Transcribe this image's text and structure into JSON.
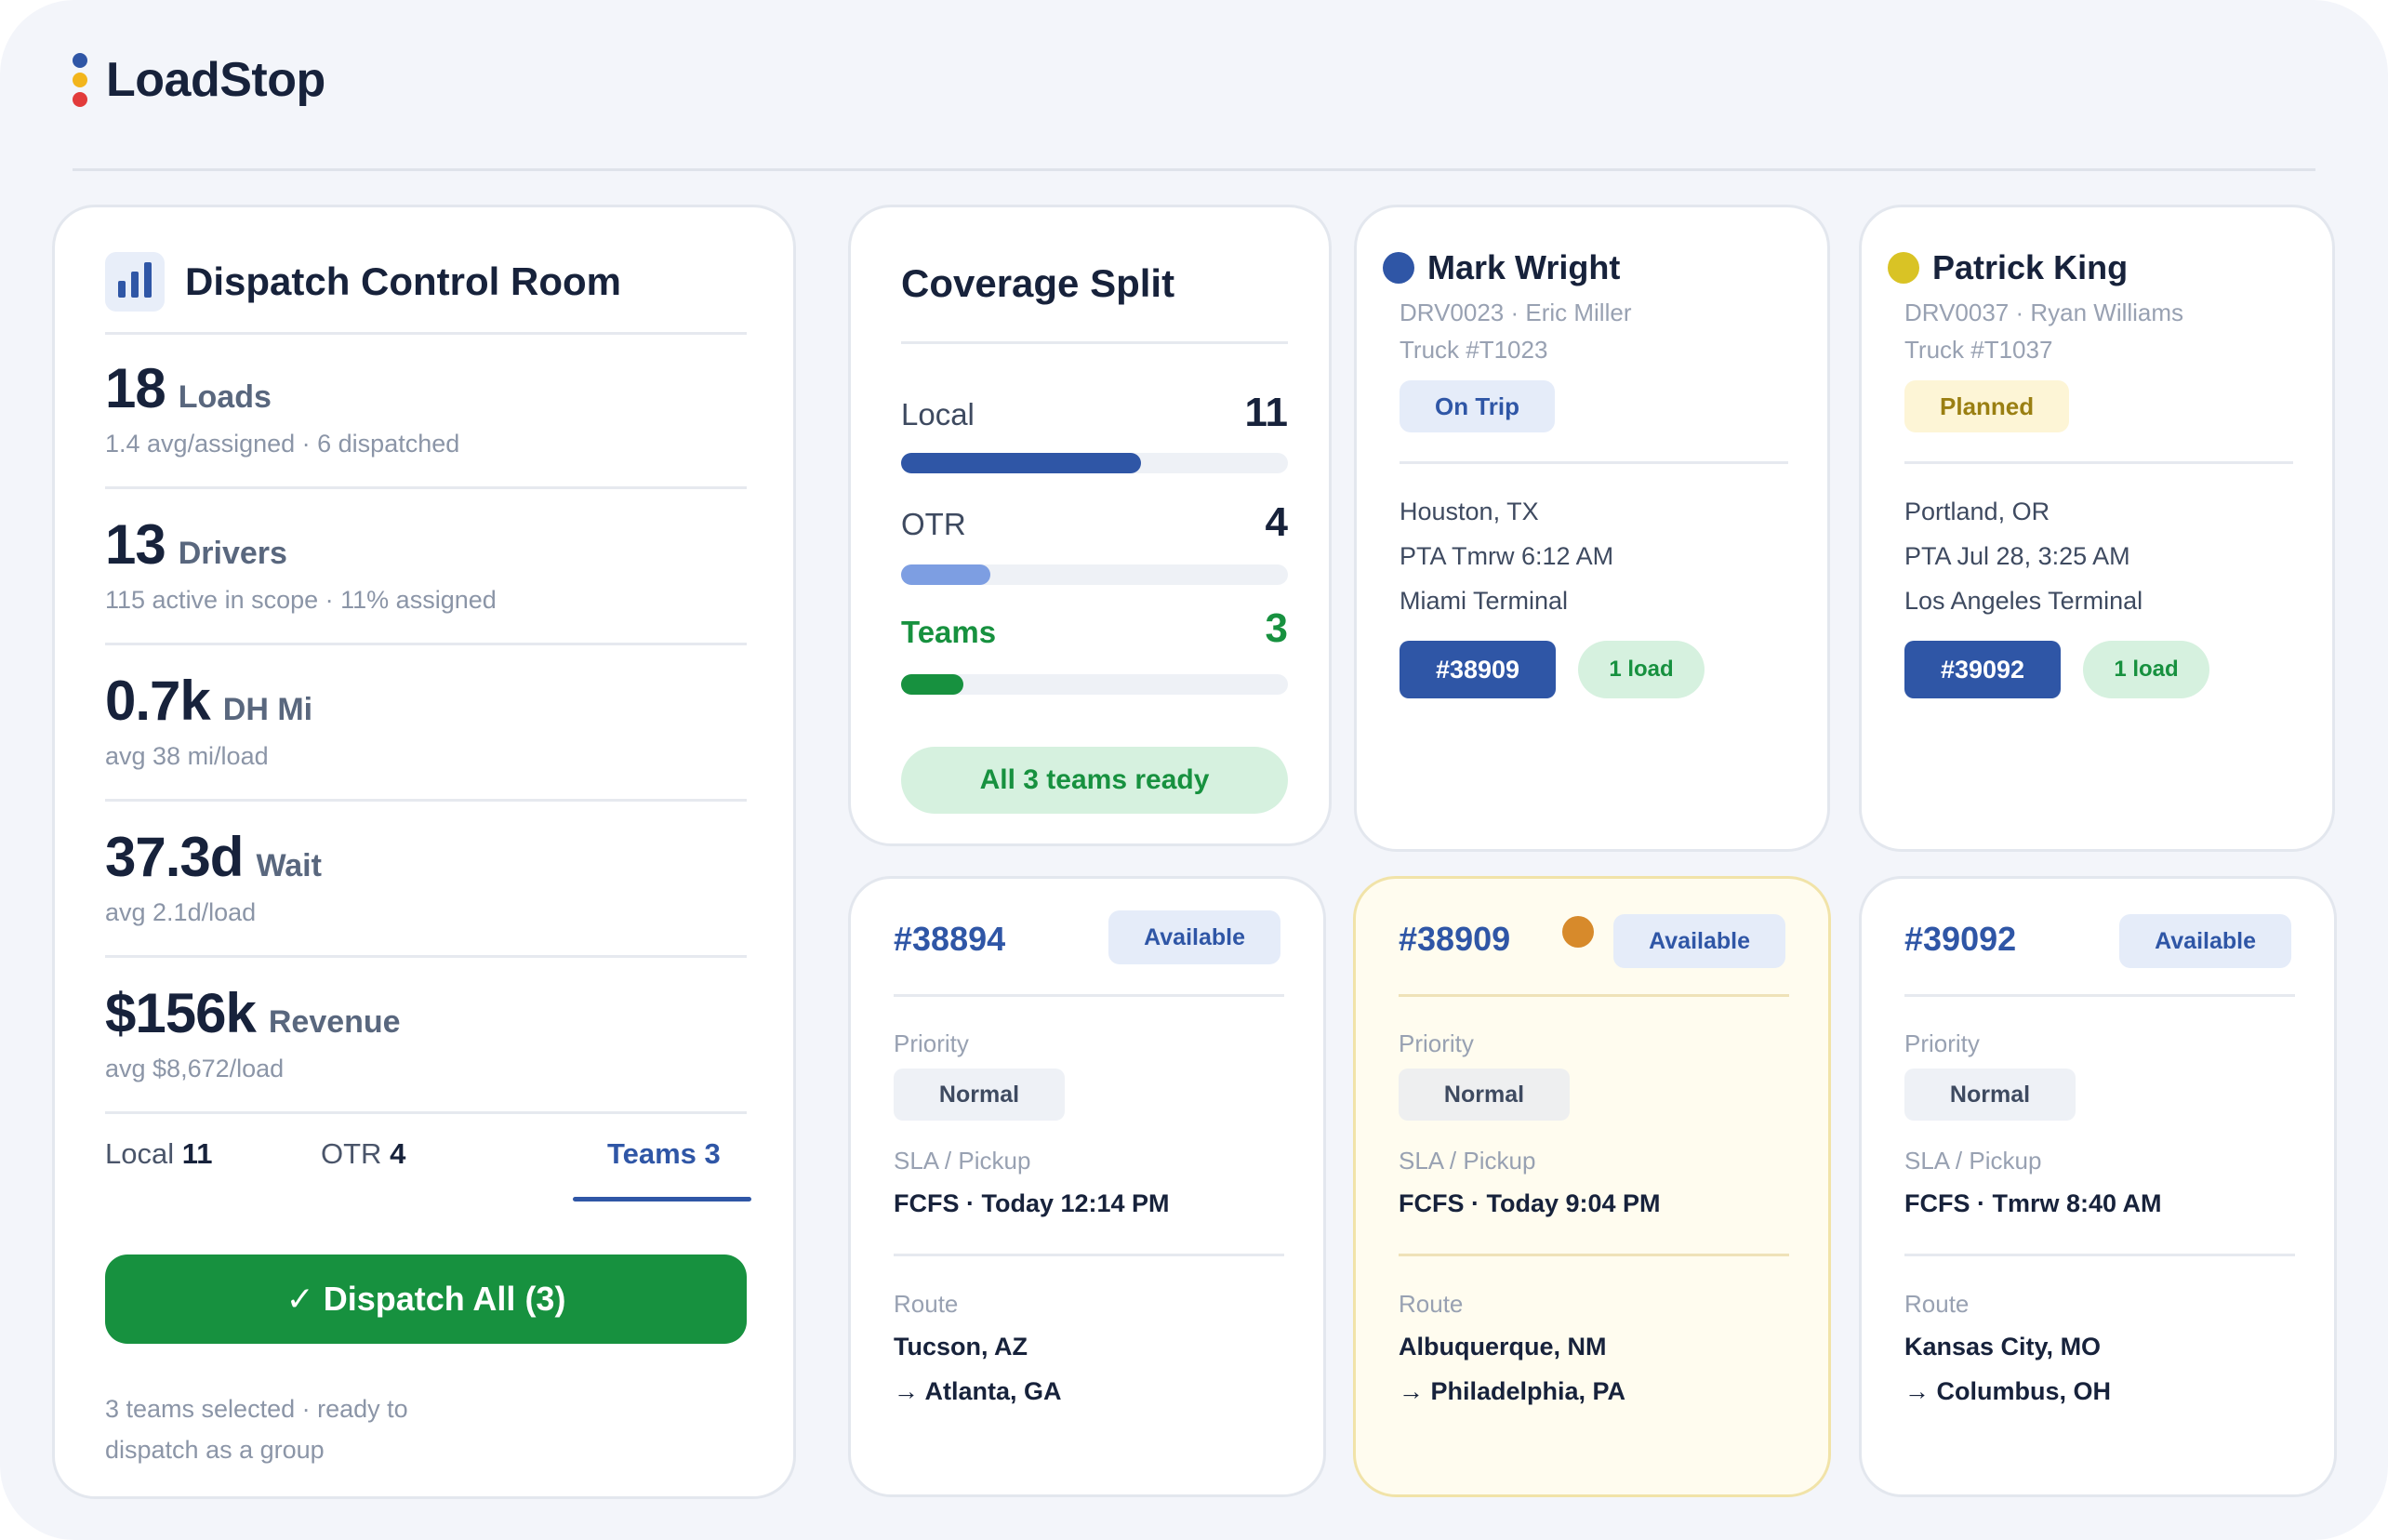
{
  "app": {
    "name": "LoadStop",
    "logo_colors": [
      "#2f56a6",
      "#f2b51c",
      "#e23b3b"
    ]
  },
  "summary": {
    "title": "Dispatch Control Room",
    "title_icon": "bar-chart-icon",
    "stats": [
      {
        "value": "18",
        "unit": "Loads",
        "sub": "1.4 avg/assigned · 6 dispatched"
      },
      {
        "value": "13",
        "unit": "Drivers",
        "sub": "115 active in scope · 11% assigned"
      },
      {
        "value": "0.7k",
        "unit": "DH Mi",
        "sub": "avg 38 mi/load"
      },
      {
        "value": "37.3d",
        "unit": "Wait",
        "sub": "avg 2.1d/load"
      },
      {
        "value": "$156k",
        "unit": "Revenue",
        "sub": "avg $8,672/load"
      }
    ],
    "tabs": [
      {
        "label": "Local",
        "count": "11"
      },
      {
        "label": "OTR",
        "count": "4"
      },
      {
        "label": "Teams",
        "count": "3",
        "active": true
      }
    ],
    "dispatch_button": {
      "icon": "check-icon",
      "glyph": "✓",
      "label": "Dispatch All (3)"
    },
    "footer": "3 teams selected · ready to dispatch as a group"
  },
  "coverage": {
    "title": "Coverage Split",
    "rows": [
      {
        "label": "Local",
        "value": "11",
        "fraction": 0.62,
        "color": "#2f56a6"
      },
      {
        "label": "OTR",
        "value": "4",
        "fraction": 0.23,
        "color": "#7d9ee2"
      },
      {
        "label": "Teams",
        "value": "3",
        "fraction": 0.16,
        "color": "#17913f"
      }
    ],
    "status_pill": "All 3 teams ready"
  },
  "drivers": [
    {
      "name": "Mark Wright",
      "dot_color": "#2f56a6",
      "meta": "DRV0023 · Eric Miller",
      "truck": "Truck #T1023",
      "status": "On Trip",
      "status_bg": "#e5ecf9",
      "status_color": "#2f56a6",
      "location": "Houston, TX",
      "pta": "PTA Tmrw 6:12 AM",
      "terminal": "Miami Terminal",
      "load_id": "#38909",
      "load_count": "1 load"
    },
    {
      "name": "Patrick King",
      "dot_color": "#d9c325",
      "meta": "DRV0037 · Ryan Williams",
      "truck": "Truck #T1037",
      "status": "Planned",
      "status_bg": "#fdf5d6",
      "status_color": "#9a7f12",
      "location": "Portland, OR",
      "pta": "PTA Jul 28, 3:25 AM",
      "terminal": "Los Angeles Terminal",
      "load_id": "#39092",
      "load_count": "1 load"
    }
  ],
  "loads": [
    {
      "id": "#38894",
      "status": "Available",
      "priority_label": "Priority",
      "priority": "Normal",
      "sla_label": "SLA / Pickup",
      "sla": "FCFS · Today 12:14 PM",
      "route_label": "Route",
      "origin": "Tucson, AZ",
      "destination": "→ Atlanta, GA"
    },
    {
      "id": "#38909",
      "status": "Available",
      "priority_label": "Priority",
      "priority": "Normal",
      "sla_label": "SLA / Pickup",
      "sla": "FCFS · Today 9:04 PM",
      "route_label": "Route",
      "origin": "Albuquerque, NM",
      "destination": "→ Philadelphia, PA",
      "highlighted": true,
      "marker_color": "#d78a2b"
    },
    {
      "id": "#39092",
      "status": "Available",
      "priority_label": "Priority",
      "priority": "Normal",
      "sla_label": "SLA / Pickup",
      "sla": "FCFS · Tmrw 8:40 AM",
      "route_label": "Route",
      "origin": "Kansas City, MO",
      "destination": "→ Columbus, OH"
    }
  ]
}
